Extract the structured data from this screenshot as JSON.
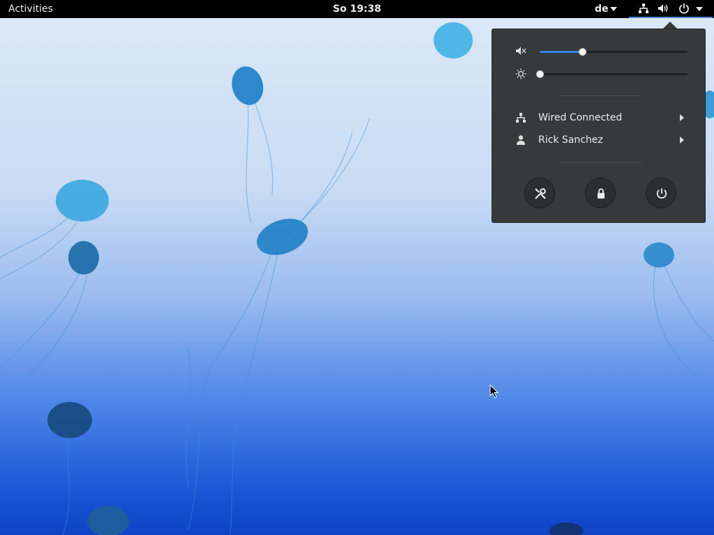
{
  "topbar": {
    "activities_label": "Activities",
    "clock_day": "So",
    "clock_time": "19:38",
    "keyboard_layout": "de",
    "status_icons": [
      "network-wired-icon",
      "volume-icon",
      "power-icon",
      "chevron-down-icon"
    ]
  },
  "system_menu": {
    "volume": {
      "icon": "volume-muted-icon",
      "level": 0.29
    },
    "brightness": {
      "icon": "brightness-icon",
      "level": 0.0
    },
    "items": [
      {
        "icon": "network-wired-icon",
        "label": "Wired Connected"
      },
      {
        "icon": "user-icon",
        "label": "Rick Sanchez"
      }
    ],
    "actions": [
      "settings-icon",
      "lock-icon",
      "power-icon"
    ]
  },
  "colors": {
    "topbar_bg": "#000000",
    "menu_bg": "#363a3b",
    "accent": "#3584e4",
    "wallpaper_top": "#dce9f8",
    "wallpaper_bottom": "#0e43c6"
  }
}
